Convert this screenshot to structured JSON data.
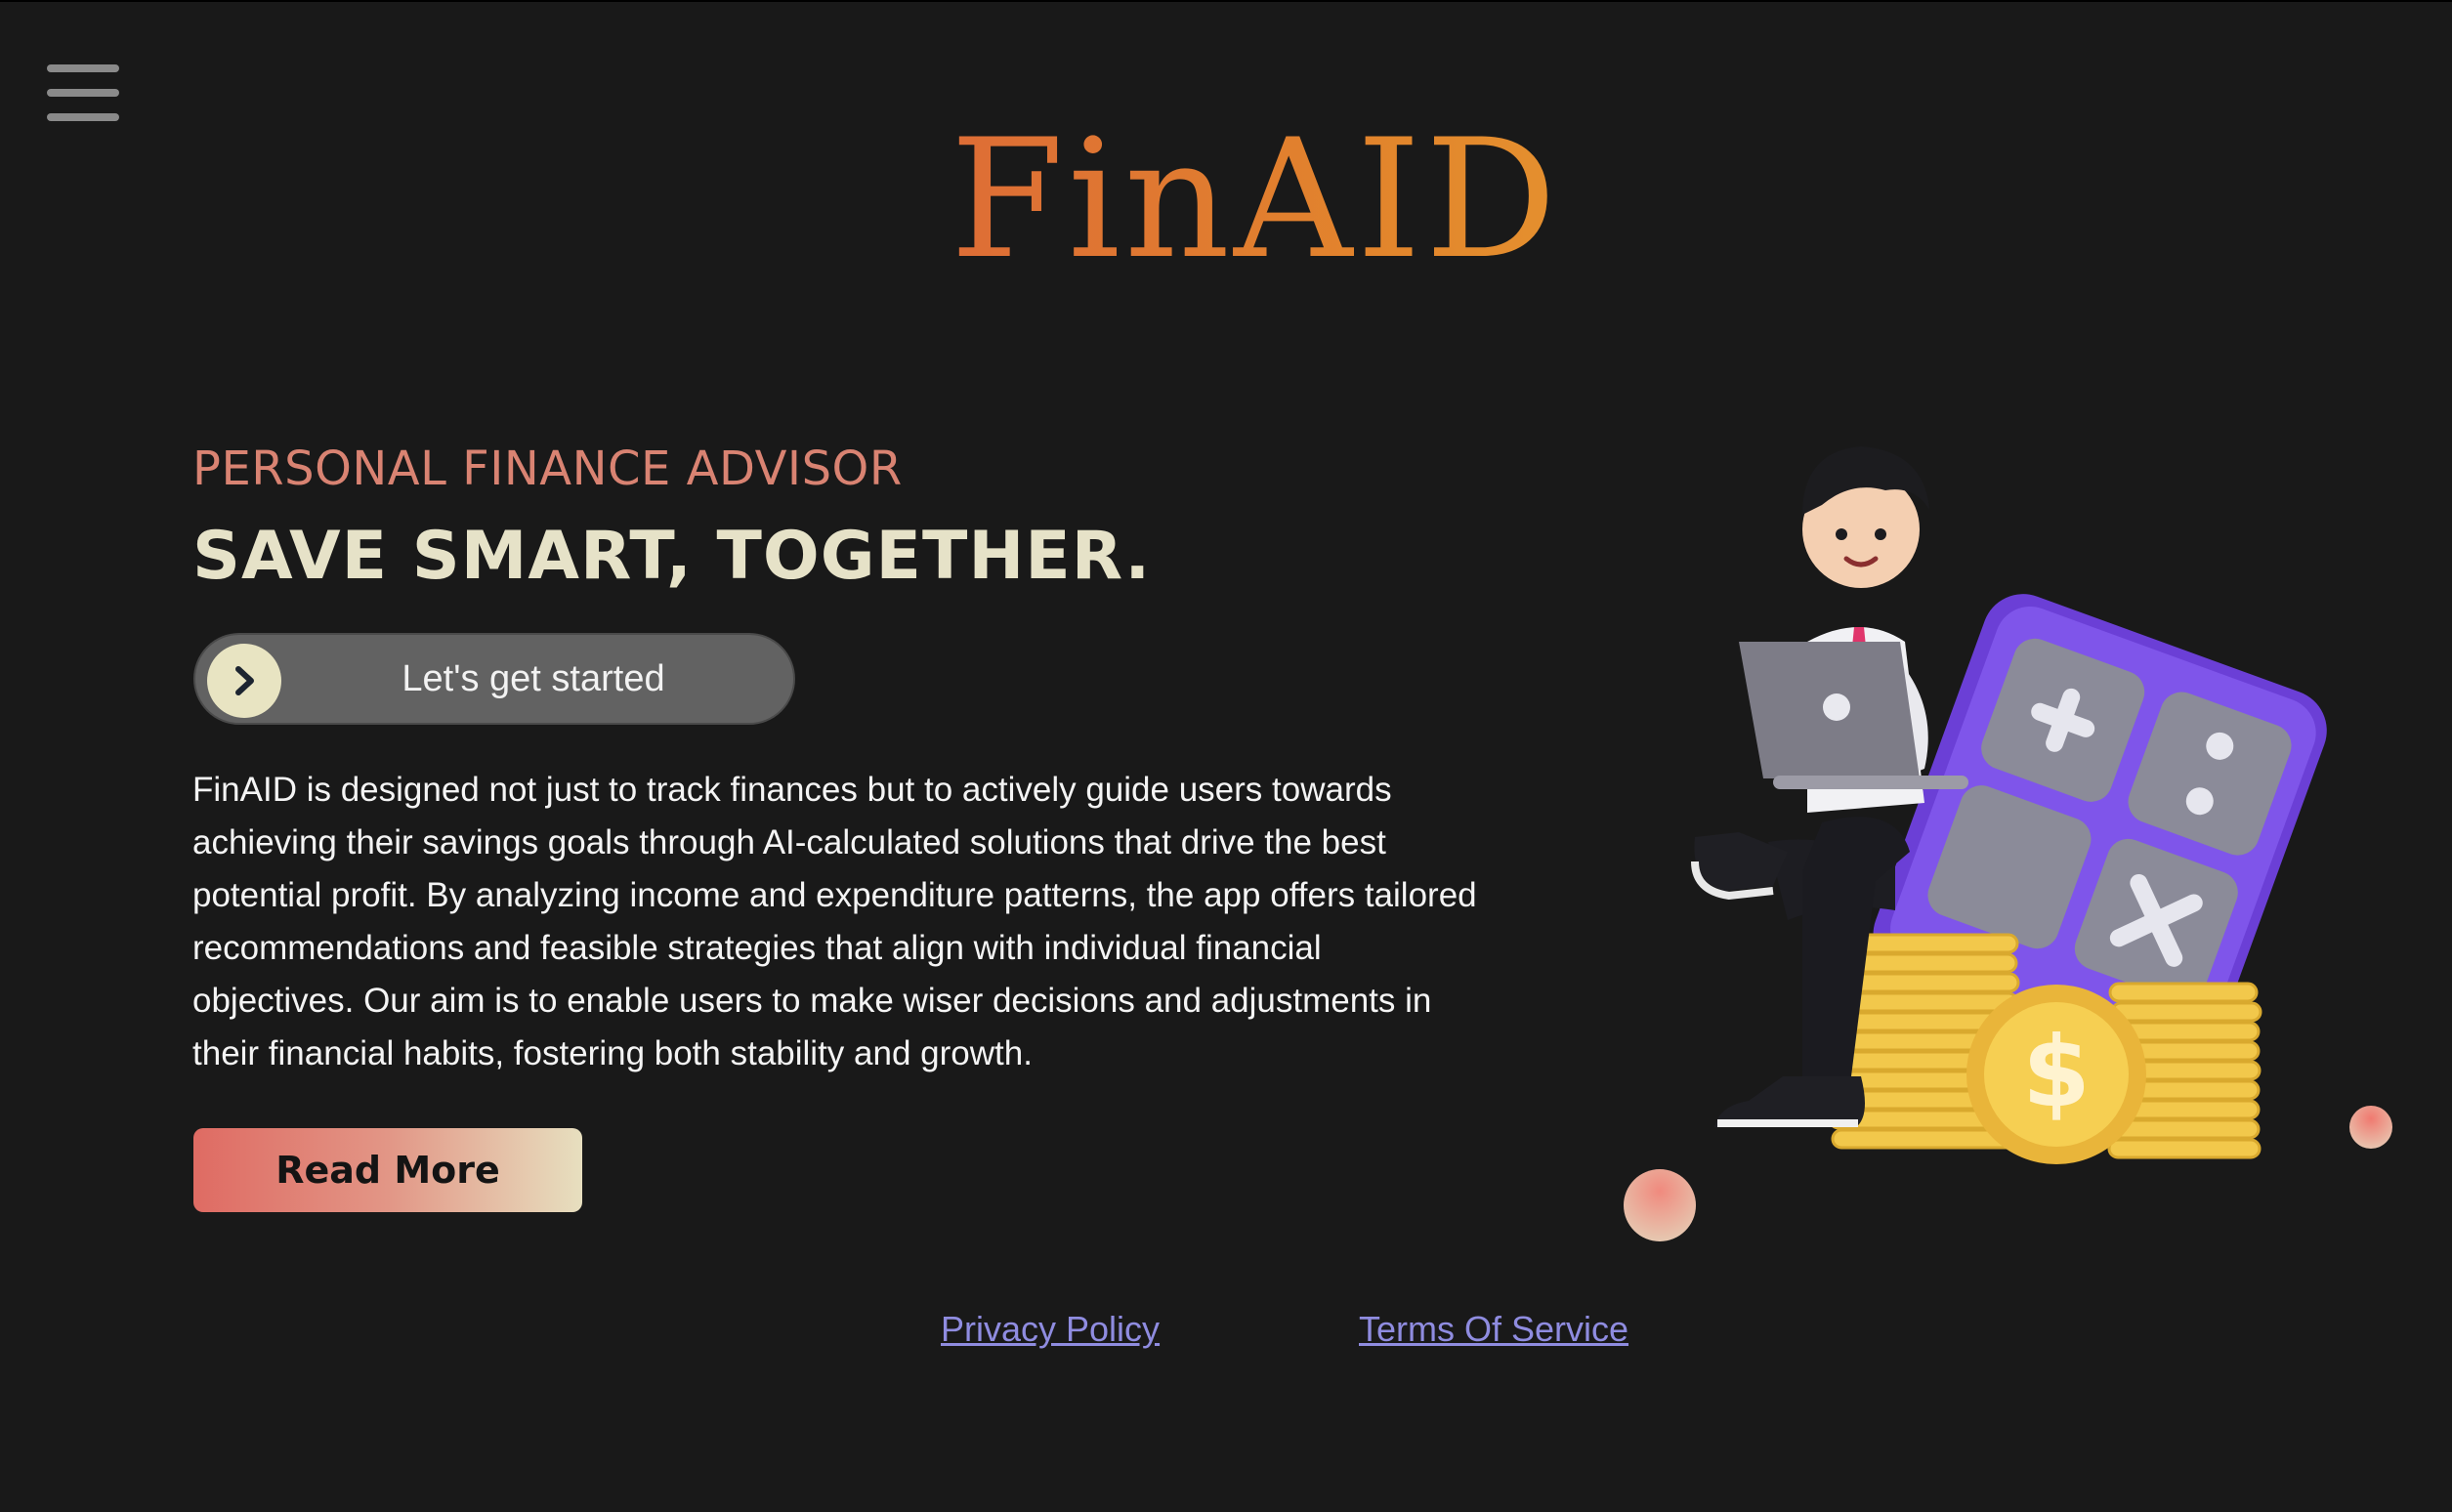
{
  "nav": {
    "menu_icon": "hamburger-menu-icon"
  },
  "brand": {
    "logo_text": "FinAID"
  },
  "hero": {
    "eyebrow": "PERSONAL FINANCE ADVISOR",
    "headline": "SAVE SMART, TOGETHER.",
    "cta_label": "Let's get started",
    "cta_icon": "chevron-right-icon",
    "description": "FinAID is designed not just to track finances but to actively guide users towards achieving their savings goals through AI-calculated solutions that drive the best potential profit. By analyzing income and expenditure patterns, the app offers tailored recommendations and feasible strategies that align with individual financial objectives. Our aim is to enable users to make wiser decisions and adjustments in their financial habits, fostering both stability and growth.",
    "read_more_label": "Read More"
  },
  "footer": {
    "privacy_label": "Privacy Policy",
    "terms_label": "Terms Of Service"
  },
  "colors": {
    "background": "#191919",
    "eyebrow": "#d98372",
    "headline": "#e6e2c8",
    "link": "#8f8ce0",
    "calculator": "#7a4fe6",
    "coins": "#f2c84b"
  }
}
